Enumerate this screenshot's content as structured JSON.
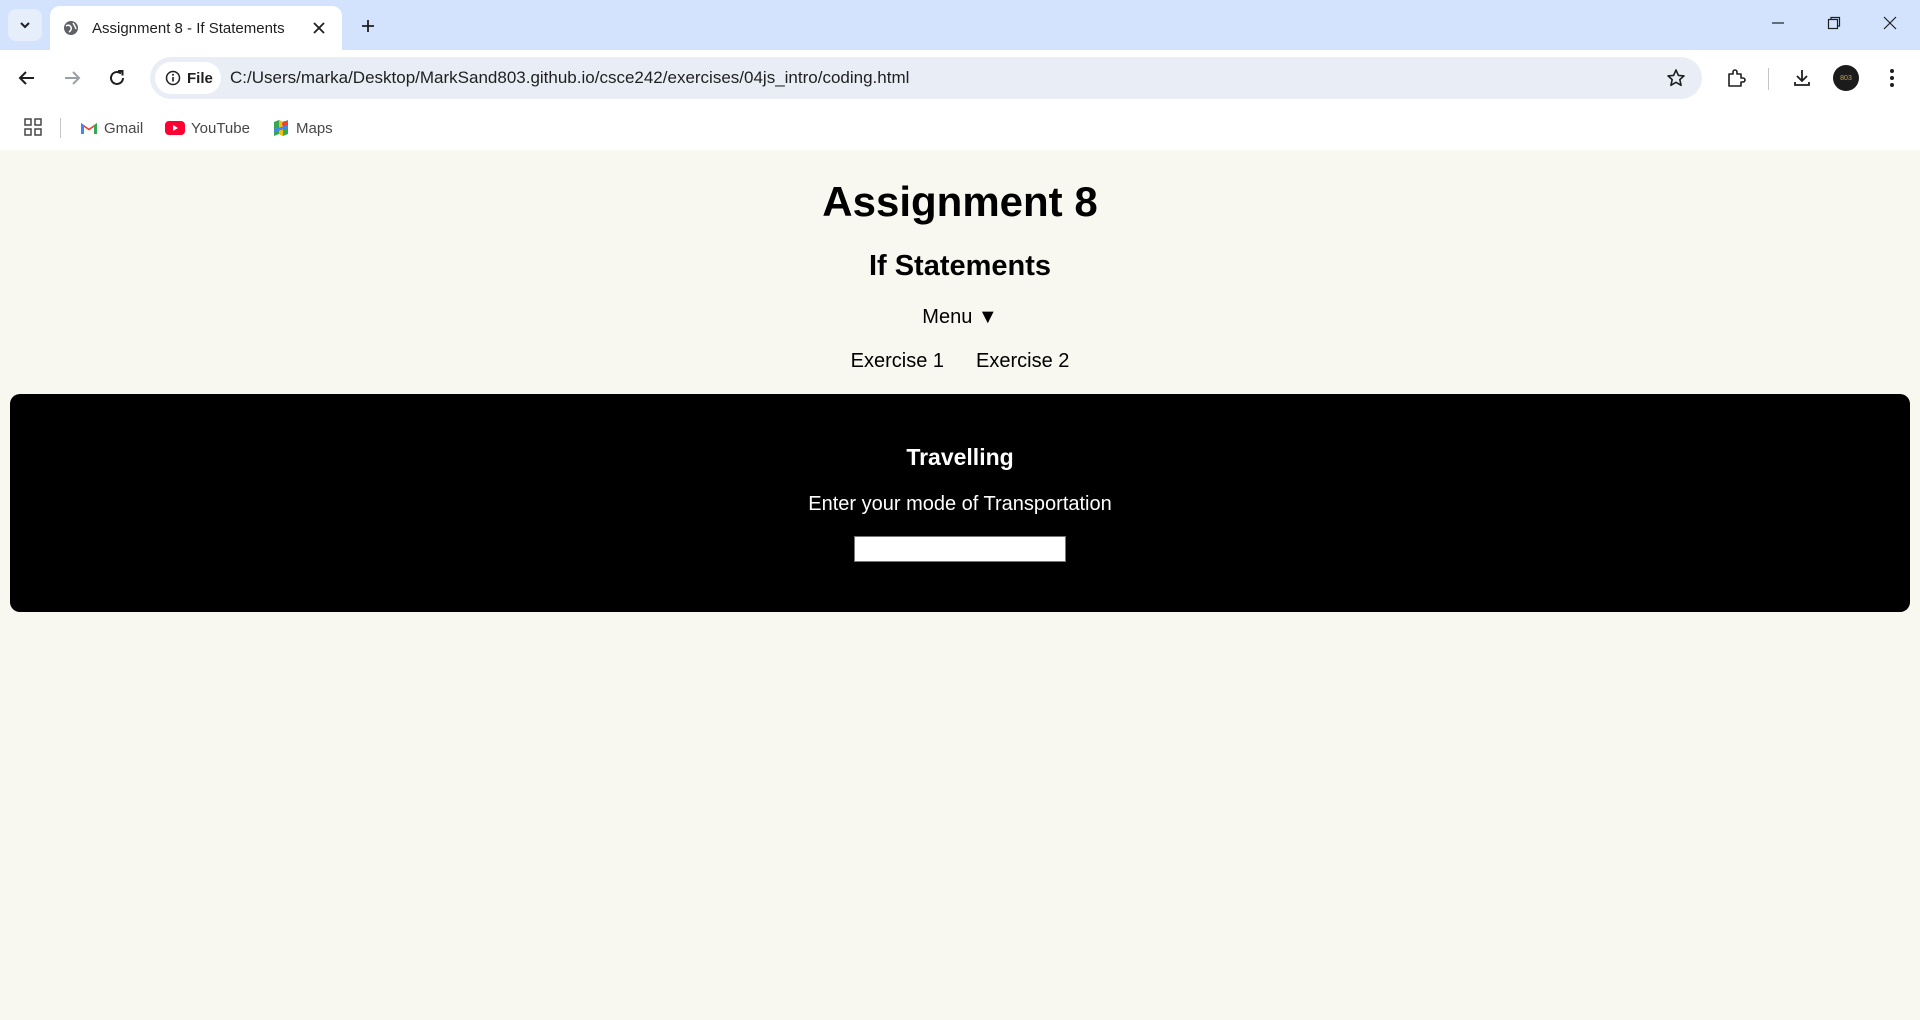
{
  "browser": {
    "tab": {
      "title": "Assignment 8 - If Statements"
    },
    "address": {
      "chip_label": "File",
      "url": "C:/Users/marka/Desktop/MarkSand803.github.io/csce242/exercises/04js_intro/coding.html"
    },
    "bookmarks": [
      {
        "label": "Gmail",
        "icon": "gmail-icon"
      },
      {
        "label": "YouTube",
        "icon": "youtube-icon"
      },
      {
        "label": "Maps",
        "icon": "maps-icon"
      }
    ],
    "profile": {
      "initials": "803"
    }
  },
  "page": {
    "title": "Assignment 8",
    "subtitle": "If Statements",
    "menu_toggle": "Menu ▼",
    "nav": [
      "Exercise 1",
      "Exercise 2"
    ],
    "panel": {
      "title": "Travelling",
      "prompt": "Enter your mode of Transportation",
      "input_value": "",
      "input_placeholder": ""
    }
  }
}
